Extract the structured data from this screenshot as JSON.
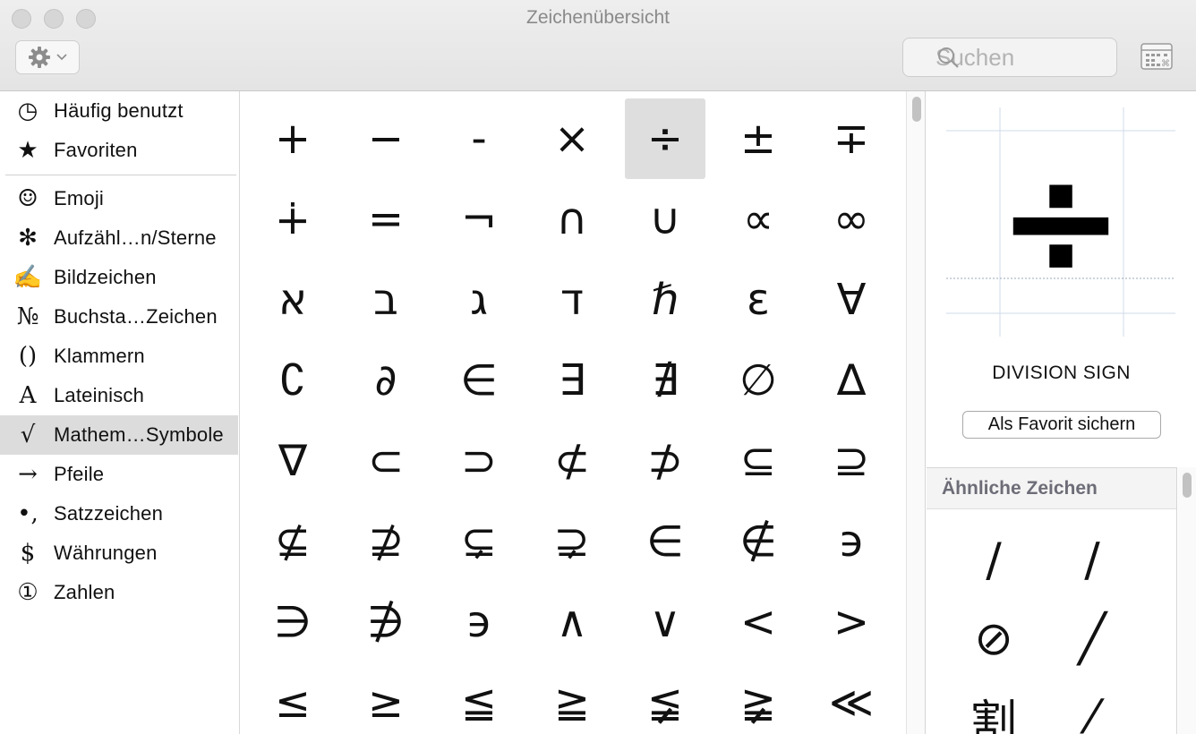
{
  "window": {
    "title": "Zeichenübersicht"
  },
  "toolbar": {
    "gear_icon": "gear-icon",
    "search_placeholder": "Suchen",
    "view_icon": "character-grid-icon"
  },
  "sidebar": {
    "items": [
      {
        "icon": "◷",
        "icon_name": "clock-icon",
        "label": "Häufig benutzt"
      },
      {
        "icon": "★",
        "icon_name": "star-icon",
        "label": "Favoriten"
      },
      {
        "icon": "☺",
        "icon_name": "smiley-icon",
        "label": "Emoji"
      },
      {
        "icon": "✻",
        "icon_name": "asterisk-icon",
        "label": "Aufzähl…n/Sterne"
      },
      {
        "icon": "✍",
        "icon_name": "writing-hand-icon",
        "label": "Bildzeichen"
      },
      {
        "icon": "№",
        "icon_name": "numero-icon",
        "label": "Buchsta…Zeichen"
      },
      {
        "icon": "()",
        "icon_name": "parentheses-icon",
        "label": "Klammern"
      },
      {
        "icon": "A",
        "icon_name": "latin-a-icon",
        "label": "Lateinisch"
      },
      {
        "icon": "√",
        "icon_name": "square-root-icon",
        "label": "Mathem…Symbole"
      },
      {
        "icon": "→",
        "icon_name": "arrow-icon",
        "label": "Pfeile"
      },
      {
        "icon": "•,",
        "icon_name": "punctuation-icon",
        "label": "Satzzeichen"
      },
      {
        "icon": "$",
        "icon_name": "dollar-icon",
        "label": "Währungen"
      },
      {
        "icon": "①",
        "icon_name": "circled-one-icon",
        "label": "Zahlen"
      }
    ],
    "selected_label": "Mathem…Symbole"
  },
  "grid": {
    "rows": [
      [
        "+",
        "−",
        "-",
        "×",
        "÷",
        "±",
        "∓"
      ],
      [
        "∔",
        "=",
        "¬",
        "∩",
        "∪",
        "∝",
        "∞"
      ],
      [
        "א",
        "ב",
        "ג",
        "ד",
        "ℏ",
        "ε",
        "∀"
      ],
      [
        "∁",
        "∂",
        "∈",
        "∃",
        "∄",
        "∅",
        "∆"
      ],
      [
        "∇",
        "⊂",
        "⊃",
        "⊄",
        "⊅",
        "⊆",
        "⊇"
      ],
      [
        "⊈",
        "⊉",
        "⊊",
        "⊋",
        "∈",
        "∉",
        "϶"
      ],
      [
        "∋",
        "∌",
        "϶",
        "∧",
        "∨",
        "<",
        ">"
      ],
      [
        "≤",
        "≥",
        "≦",
        "≧",
        "≨",
        "≩",
        "≪"
      ]
    ],
    "selected_char": "÷"
  },
  "detail": {
    "preview_char": "÷",
    "char_name": "DIVISION SIGN",
    "favorite_button": "Als Favorit sichern",
    "similar_header": "Ähnliche Zeichen",
    "similar_chars": [
      "/",
      "∕",
      "⊘",
      "╱",
      "割",
      "⁄"
    ]
  }
}
